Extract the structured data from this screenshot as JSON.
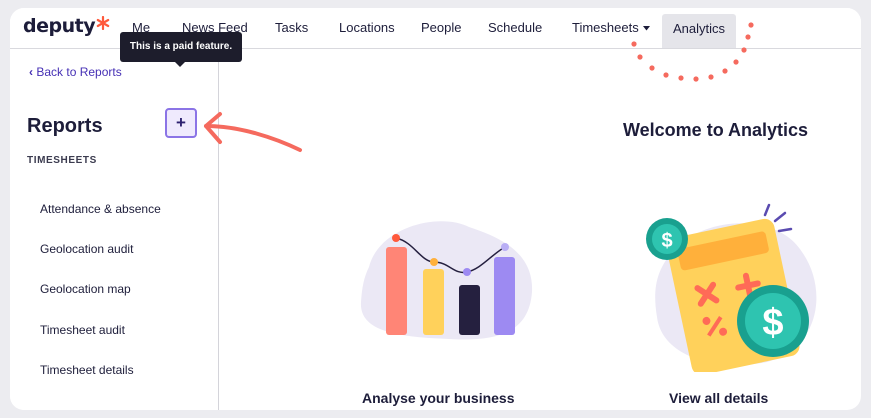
{
  "brand": {
    "name": "deputy",
    "accent": "#ff5a3c"
  },
  "nav": {
    "items": [
      {
        "label": "Me"
      },
      {
        "label": "News Feed"
      },
      {
        "label": "Tasks"
      },
      {
        "label": "Locations"
      },
      {
        "label": "People"
      },
      {
        "label": "Schedule"
      },
      {
        "label": "Timesheets"
      },
      {
        "label": "Analytics",
        "active": true
      }
    ]
  },
  "sidebar": {
    "back_label": "Back to Reports",
    "tooltip": "This is a paid feature.",
    "title": "Reports",
    "add_label": "+",
    "section": "TIMESHEETS",
    "items": [
      {
        "label": "Attendance & absence"
      },
      {
        "label": "Geolocation audit"
      },
      {
        "label": "Geolocation map"
      },
      {
        "label": "Timesheet audit"
      },
      {
        "label": "Timesheet details"
      }
    ]
  },
  "main": {
    "welcome": "Welcome to Analytics",
    "cards": [
      {
        "label": "Analyse your business",
        "icon": "bar-chart-illustration"
      },
      {
        "label": "View all details",
        "icon": "calculator-illustration"
      }
    ]
  },
  "annotation": {
    "color": "#f56a5e"
  }
}
